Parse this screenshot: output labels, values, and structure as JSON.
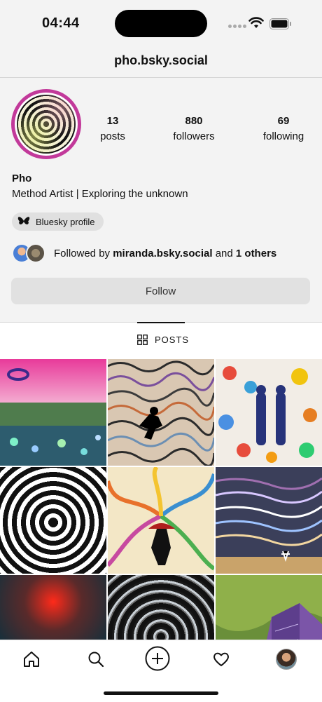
{
  "status_bar": {
    "time": "04:44"
  },
  "header": {
    "title": "pho.bsky.social"
  },
  "profile": {
    "stats": [
      {
        "value": "13",
        "label": "posts"
      },
      {
        "value": "880",
        "label": "followers"
      },
      {
        "value": "69",
        "label": "following"
      }
    ],
    "name": "Pho",
    "bio": "Method Artist | Exploring the unknown",
    "chip_label": "Bluesky profile",
    "followed_by_prefix": "Followed by",
    "followed_by_user": "miranda.bsky.social",
    "followed_by_and": "and",
    "followed_by_others": "1 others",
    "follow_button": "Follow"
  },
  "tabs": {
    "posts_label": "POSTS"
  },
  "colors": {
    "avatar_ring": "#c2399a",
    "background_top": "#f3f3f3",
    "button_bg": "#e1e1e1"
  },
  "bottom_nav": [
    "home-icon",
    "search-icon",
    "create-icon",
    "heart-icon",
    "profile-avatar"
  ]
}
